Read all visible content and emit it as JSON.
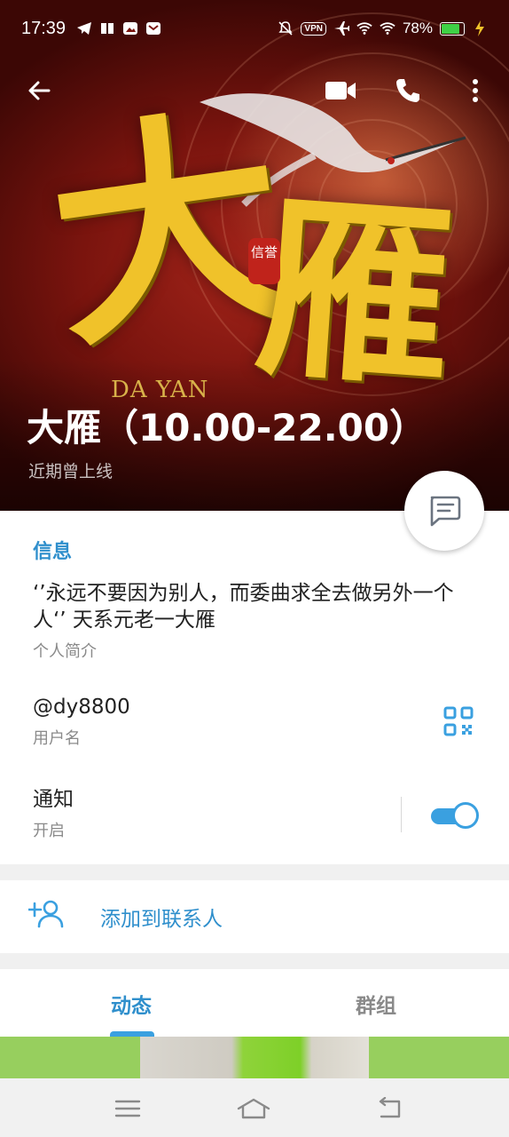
{
  "status_bar": {
    "time": "17:39",
    "vpn": "VPN",
    "battery": "78%",
    "battery_level": 0.78
  },
  "header": {
    "artwork": {
      "glyph_large_1": "大",
      "glyph_large_2": "雁",
      "seal": "信誉",
      "latin": "DA YAN"
    },
    "name": "大雁（10.00-22.00）",
    "status": "近期曾上线"
  },
  "info": {
    "section_title": "信息",
    "bio": "‘’永远不要因为别人，而委曲求全去做另外一个人‘’ 天系元老一大雁",
    "bio_label": "个人简介",
    "username": "@dy8800",
    "username_label": "用户名",
    "notifications": "通知",
    "notifications_state": "开启",
    "notifications_on": true
  },
  "actions": {
    "add_contact": "添加到联系人"
  },
  "tabs": [
    {
      "label": "动态",
      "active": true
    },
    {
      "label": "群组",
      "active": false
    }
  ],
  "colors": {
    "accent": "#2f8fcc",
    "toggle": "#3aa0e0",
    "hero_red": "#7a140e",
    "gold": "#f0c22a"
  }
}
